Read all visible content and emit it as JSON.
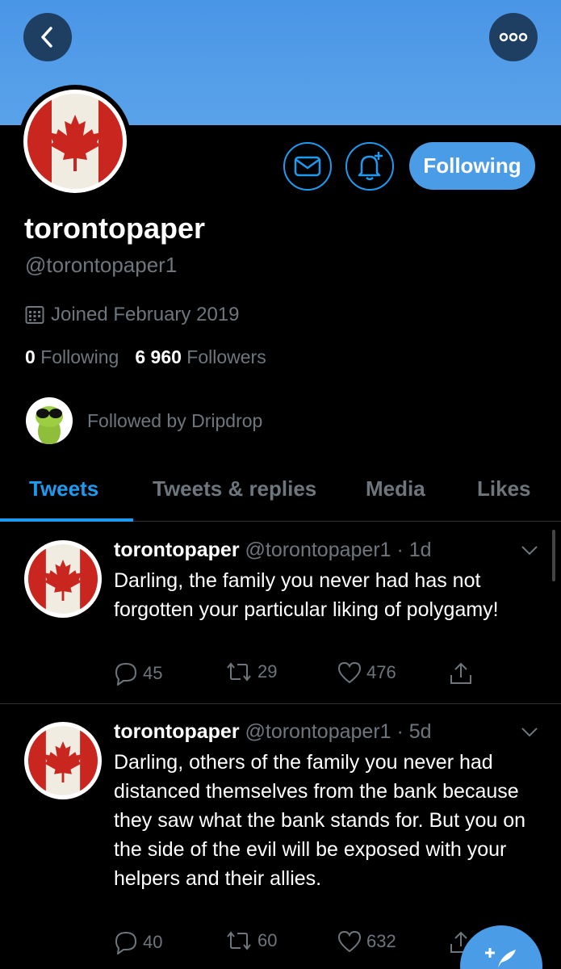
{
  "header": {
    "back_icon": "chevron-left-icon",
    "more_icon": "ellipsis-icon",
    "banner_color": "#4a95e6"
  },
  "profile": {
    "display_name": "torontopaper",
    "handle": "@torontopaper1",
    "joined": "Joined February 2019",
    "following_count": "0",
    "following_label": "Following",
    "followers_count": "6 960",
    "followers_label": "Followers",
    "followed_by": "Followed by Dripdrop",
    "avatar": "canada-flag-avatar"
  },
  "actions": {
    "message_icon": "envelope-icon",
    "notify_icon": "bell-plus-icon",
    "following_button": "Following"
  },
  "tabs": [
    {
      "label": "Tweets",
      "active": true
    },
    {
      "label": "Tweets & replies",
      "active": false
    },
    {
      "label": "Media",
      "active": false
    },
    {
      "label": "Likes",
      "active": false
    }
  ],
  "tweets": [
    {
      "name": "torontopaper",
      "meta": "@torontopaper1 · 1d",
      "text": "Darling, the family you never had has not forgotten your particular liking of polygamy!",
      "replies": "45",
      "retweets": "29",
      "likes": "476"
    },
    {
      "name": "torontopaper",
      "meta": "@torontopaper1 · 5d",
      "text": "Darling, others of the family you never had distanced themselves from the bank because they saw what the bank stands for. But you on the side of the evil will be exposed with your helpers and their allies.",
      "replies": "40",
      "retweets": "60",
      "likes": "632"
    }
  ],
  "colors": {
    "accent": "#1d9bf0",
    "muted": "#6e767d",
    "background": "#000000"
  }
}
